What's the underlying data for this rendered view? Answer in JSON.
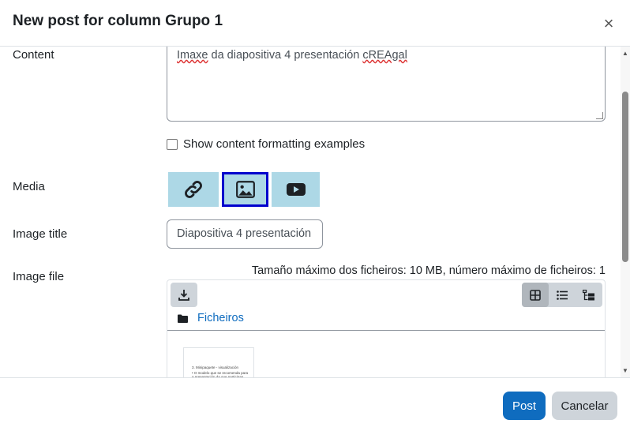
{
  "header": {
    "title": "New post for column Grupo 1",
    "close_label": "×"
  },
  "form": {
    "content_label": "Content",
    "content_value_part1": "Imaxe",
    "content_value_part2": " da diapositiva 4 presentación ",
    "content_value_part3": "cREAgal",
    "formatting_label": "Show content formatting examples",
    "media_label": "Media",
    "media_buttons": [
      {
        "icon": "link-icon",
        "active": false
      },
      {
        "icon": "image-icon",
        "active": true
      },
      {
        "icon": "youtube-icon",
        "active": false
      }
    ],
    "image_title_label": "Image title",
    "image_title_value": "Diapositiva 4 presentación",
    "image_file_label": "Image file",
    "max_size_text": "Tamaño máximo dos ficheiros: 10 MB, número máximo de ficheiros: 1",
    "folder_link": "Ficheiros",
    "thumbnail_title": "3. Minipaquete - visualización",
    "thumbnail_body": "• O modelo que se recomenda para a presentación da que participan aos os alumnos"
  },
  "footer": {
    "post_label": "Post",
    "cancel_label": "Cancelar"
  },
  "colors": {
    "primary": "#0f6cbf",
    "media_bg": "#add8e6",
    "media_active_border": "#0000cd"
  }
}
